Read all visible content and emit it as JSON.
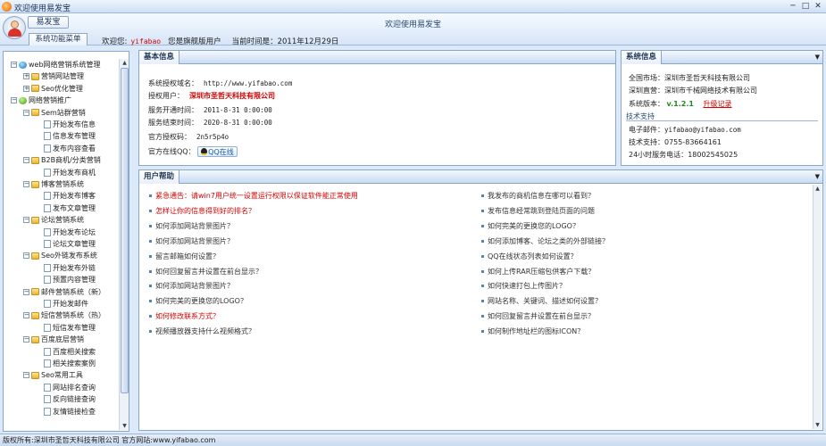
{
  "window": {
    "title": "欢迎使用易发宝",
    "minimize": "─",
    "maximize": "□",
    "close": "✕"
  },
  "header": {
    "app_name": "易发宝",
    "center_title": "欢迎使用易发宝",
    "menu_tab": "系统功能菜单",
    "welcome_label": "欢迎您:",
    "username": "yifabao",
    "user_level": "您是旗舰版用户",
    "time_label": "当前时间是：2011年12月29日"
  },
  "tree": [
    {
      "label": "web网络营销系统管理",
      "level": 0,
      "icon": "globe-icon",
      "toggle": "−"
    },
    {
      "label": "营销网站管理",
      "level": 1,
      "icon": "folder-icon",
      "toggle": "+"
    },
    {
      "label": "Seo优化管理",
      "level": 1,
      "icon": "folder-icon",
      "toggle": "+"
    },
    {
      "label": "网络营销推广",
      "level": 0,
      "icon": "leaf-icon",
      "toggle": "−"
    },
    {
      "label": "Sem站群营销",
      "level": 1,
      "icon": "folder-icon",
      "toggle": "−"
    },
    {
      "label": "开始发布信息",
      "level": 2,
      "icon": "page-icon"
    },
    {
      "label": "信息发布管理",
      "level": 2,
      "icon": "page-icon"
    },
    {
      "label": "发布内容查看",
      "level": 2,
      "icon": "page-icon"
    },
    {
      "label": "B2B商机/分类营销",
      "level": 1,
      "icon": "folder-icon",
      "toggle": "−"
    },
    {
      "label": "开始发布商机",
      "level": 2,
      "icon": "page-icon"
    },
    {
      "label": "博客营销系统",
      "level": 1,
      "icon": "folder-icon",
      "toggle": "−"
    },
    {
      "label": "开始发布博客",
      "level": 2,
      "icon": "page-icon"
    },
    {
      "label": "发布文章管理",
      "level": 2,
      "icon": "page-icon"
    },
    {
      "label": "论坛营销系统",
      "level": 1,
      "icon": "folder-icon",
      "toggle": "−"
    },
    {
      "label": "开始发布论坛",
      "level": 2,
      "icon": "page-icon"
    },
    {
      "label": "论坛文章管理",
      "level": 2,
      "icon": "page-icon"
    },
    {
      "label": "Seo外链发布系统",
      "level": 1,
      "icon": "folder-icon",
      "toggle": "−"
    },
    {
      "label": "开始发布外链",
      "level": 2,
      "icon": "page-icon"
    },
    {
      "label": "预置内容管理",
      "level": 2,
      "icon": "page-icon"
    },
    {
      "label": "邮件营销系统（新）",
      "level": 1,
      "icon": "folder-icon",
      "toggle": "−"
    },
    {
      "label": "开始发邮件",
      "level": 2,
      "icon": "page-icon"
    },
    {
      "label": "短信营销系统（热）",
      "level": 1,
      "icon": "folder-icon",
      "toggle": "−"
    },
    {
      "label": "短信发布管理",
      "level": 2,
      "icon": "page-icon"
    },
    {
      "label": "百度底层营销",
      "level": 1,
      "icon": "folder-icon",
      "toggle": "−"
    },
    {
      "label": "百度相关搜索",
      "level": 2,
      "icon": "page-icon"
    },
    {
      "label": "相关搜索案例",
      "level": 2,
      "icon": "page-icon"
    },
    {
      "label": "Seo常用工具",
      "level": 1,
      "icon": "folder-icon",
      "toggle": "−"
    },
    {
      "label": "网站排名查询",
      "level": 2,
      "icon": "page-icon"
    },
    {
      "label": "反向链接查询",
      "level": 2,
      "icon": "page-icon"
    },
    {
      "label": "友情链接检查",
      "level": 2,
      "icon": "page-icon"
    }
  ],
  "basic_info": {
    "tab": "基本信息",
    "rows": [
      {
        "label": "系统授权域名：",
        "value": "http://www.yifabao.com",
        "style": "mono"
      },
      {
        "label": "授权用户：",
        "value": "深圳市圣哲天科技有限公司",
        "style": "red-bold"
      },
      {
        "label": "服务开通时间：",
        "value": "2011-8-31 0:00:00",
        "style": "mono"
      },
      {
        "label": "服务结束时间：",
        "value": "2020-8-31 0:00:00",
        "style": "mono"
      },
      {
        "label": "官方授权码：",
        "value": "2n5r5p4o",
        "style": "mono"
      }
    ],
    "qq_label": "官方在线QQ：",
    "qq_button": "QQ在线"
  },
  "system_info": {
    "tab": "系统信息",
    "rows": [
      {
        "label": "全国市场：",
        "value": "深圳市圣哲天科技有限公司"
      },
      {
        "label": "深圳直营：",
        "value": "深圳市千械网络技术有限公司"
      }
    ],
    "version_label": "系统版本：",
    "version": "v.1.2.1",
    "upgrade_link": "升级记录",
    "support_title": "技术支持",
    "support_rows": [
      {
        "label": "电子邮件：",
        "value": "yifabao@yifabao.com"
      },
      {
        "label": "技术支持：",
        "value": "0755-83664161"
      },
      {
        "label": "24小时服务电话：",
        "value": "18002545025"
      }
    ]
  },
  "help": {
    "tab": "用户帮助",
    "left": [
      {
        "text": "紧急通告：请win7用户统一设置运行权限以保证软件能正常使用",
        "hot": true
      },
      {
        "text": "怎样让你的信息得到好的排名？",
        "hot": true
      },
      {
        "text": "如何添加网站背景图片？",
        "hot": false
      },
      {
        "text": "如何添加网站背景图片？",
        "hot": false
      },
      {
        "text": "留言邮箱如何设置？",
        "hot": false
      },
      {
        "text": "如何回复留言并设置在前台显示？",
        "hot": false
      },
      {
        "text": "如何添加网站背景图片？",
        "hot": false
      },
      {
        "text": "如何完美的更换您的LOGO？",
        "hot": false
      },
      {
        "text": "如何修改联系方式？",
        "hot": true
      },
      {
        "text": "视频播放器支持什么视频格式？",
        "hot": false
      }
    ],
    "right": [
      {
        "text": "我发布的商机信息在哪可以看到？",
        "hot": false
      },
      {
        "text": "发布信息经常跳到登陆页面的问题",
        "hot": false
      },
      {
        "text": "如何完美的更换您的LOGO？",
        "hot": false
      },
      {
        "text": "如何添加博客、论坛之类的外部链接？",
        "hot": false
      },
      {
        "text": "QQ在线状态列表如何设置？",
        "hot": false
      },
      {
        "text": "如何上传RAR压缩包供客户下载？",
        "hot": false
      },
      {
        "text": "如何快速打包上传图片？",
        "hot": false
      },
      {
        "text": "网站名称、关键词、描述如何设置？",
        "hot": false
      },
      {
        "text": "如何回复留言并设置在前台显示？",
        "hot": false
      },
      {
        "text": "如何制作地址栏的图标ICON？",
        "hot": false
      }
    ]
  },
  "status_bar": {
    "text": "版权所有:深圳市圣哲天科技有限公司 官方网站:www.yifabao.com"
  },
  "colors": {
    "accent_red": "#d60000",
    "version_green": "#1e8a1e",
    "border_blue": "#8aa6c9"
  }
}
